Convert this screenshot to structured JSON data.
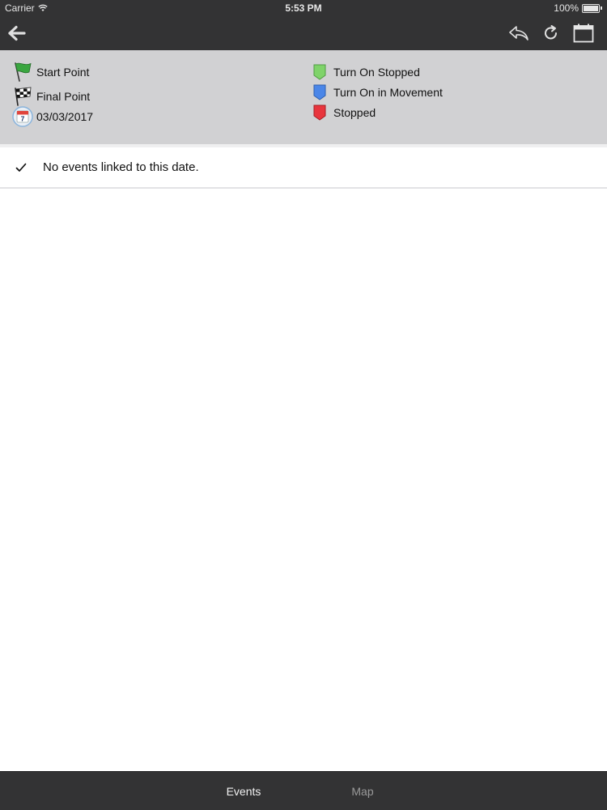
{
  "status_bar": {
    "carrier": "Carrier",
    "time": "5:53 PM",
    "battery": "100%"
  },
  "nav": {
    "back_icon": "arrow-left-icon",
    "reply_icon": "reply-icon",
    "refresh_icon": "refresh-icon",
    "calendar_icon": "calendar-icon"
  },
  "legend": {
    "start_point": "Start Point",
    "final_point": "Final Point",
    "date": "03/03/2017",
    "date_day": "7",
    "turn_on_stopped": "Turn On Stopped",
    "turn_on_movement": "Turn On in Movement",
    "stopped": "Stopped"
  },
  "events": {
    "empty_message": "No events linked to this date."
  },
  "tabs": {
    "events": "Events",
    "map": "Map"
  },
  "colors": {
    "bar": "#333334",
    "legend_bg": "#d1d1d3",
    "green_marker": "#7fd36a",
    "blue_marker": "#4a86e8",
    "red_marker": "#e8353d",
    "flag_green": "#3aa640"
  }
}
